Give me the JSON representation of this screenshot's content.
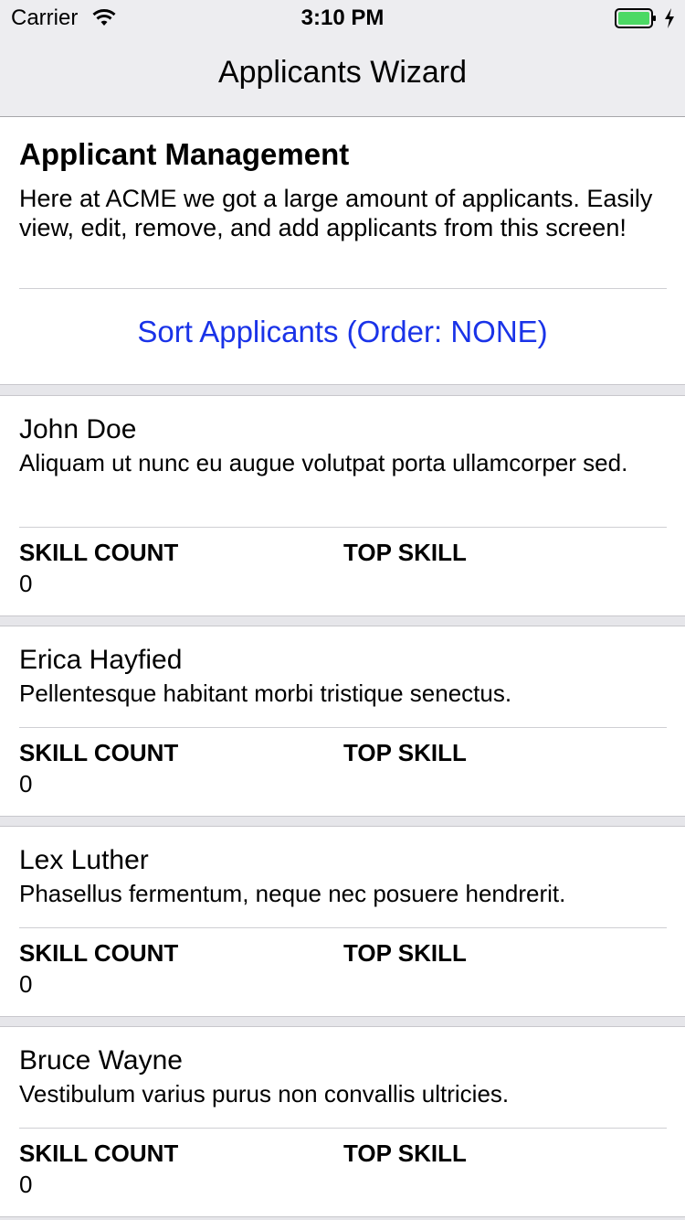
{
  "status": {
    "carrier": "Carrier",
    "time": "3:10 PM"
  },
  "nav": {
    "title": "Applicants Wizard"
  },
  "header": {
    "title": "Applicant Management",
    "description": "Here at ACME we got a large amount of applicants. Easily view, edit, remove, and add applicants from this screen!",
    "sort_label": "Sort Applicants (Order: NONE)"
  },
  "applicants": [
    {
      "name": "John Doe",
      "description": "Aliquam ut nunc eu augue volutpat porta ullamcorper sed.",
      "skill_count_label": "SKILL COUNT",
      "top_skill_label": "TOP SKILL",
      "skill_count": "0"
    },
    {
      "name": "Erica Hayfied",
      "description": "Pellentesque habitant morbi tristique senectus.",
      "skill_count_label": "SKILL COUNT",
      "top_skill_label": "TOP SKILL",
      "skill_count": "0"
    },
    {
      "name": "Lex Luther",
      "description": "Phasellus fermentum, neque nec posuere hendrerit.",
      "skill_count_label": "SKILL COUNT",
      "top_skill_label": "TOP SKILL",
      "skill_count": "0"
    },
    {
      "name": "Bruce Wayne",
      "description": "Vestibulum varius purus non convallis ultricies.",
      "skill_count_label": "SKILL COUNT",
      "top_skill_label": "TOP SKILL",
      "skill_count": "0"
    }
  ],
  "colors": {
    "accent": "#1a33e8",
    "battery": "#4cd964",
    "bar_bg": "#ededf0"
  },
  "icons": {
    "wifi": "wifi-icon",
    "battery": "battery-icon",
    "charging": "charging-bolt-icon"
  }
}
